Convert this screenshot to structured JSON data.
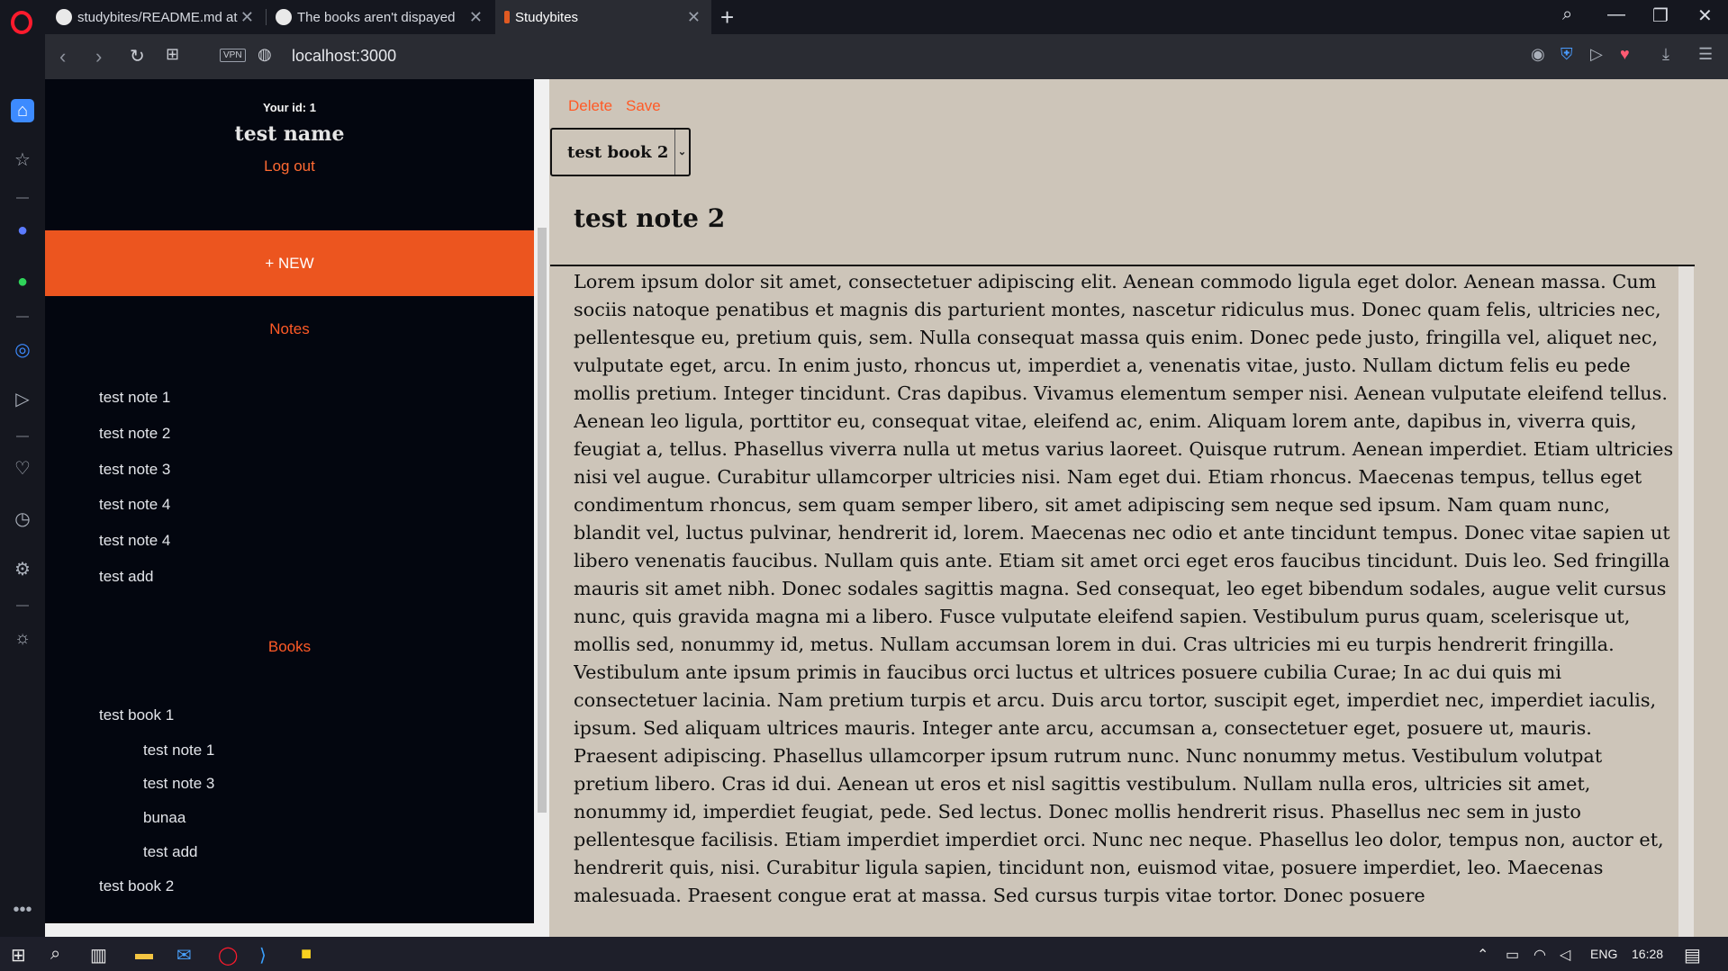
{
  "browser": {
    "tabs": [
      {
        "title": "studybites/README.md at",
        "active": false
      },
      {
        "title": "The books aren't dispayed",
        "active": false
      },
      {
        "title": "Studybites",
        "active": true
      }
    ],
    "url": "localhost:3000",
    "vpn_label": "VPN"
  },
  "sidebar": {
    "user_id_label": "Your id: 1",
    "user_name": "test name",
    "logout_label": "Log out",
    "new_button_label": "+ NEW",
    "notes_heading": "Notes",
    "notes": [
      "test note 1",
      "test note 2",
      "test note 3",
      "test note 4",
      "test note 4",
      "test add"
    ],
    "books_heading": "Books",
    "books": [
      {
        "title": "test book 1",
        "notes": [
          "test note 1",
          "test note 3",
          "bunaa",
          "test add"
        ]
      },
      {
        "title": "test book 2",
        "notes": []
      }
    ]
  },
  "main": {
    "delete_label": "Delete",
    "save_label": "Save",
    "selected_book": "test book 2",
    "note_title": "test note 2",
    "note_body": "Lorem ipsum dolor sit amet, consectetuer adipiscing elit. Aenean commodo ligula eget dolor. Aenean massa. Cum sociis natoque penatibus et magnis dis parturient montes, nascetur ridiculus mus. Donec quam felis, ultricies nec, pellentesque eu, pretium quis, sem. Nulla consequat massa quis enim. Donec pede justo, fringilla vel, aliquet nec, vulputate eget, arcu. In enim justo, rhoncus ut, imperdiet a, venenatis vitae, justo. Nullam dictum felis eu pede mollis pretium. Integer tincidunt. Cras dapibus. Vivamus elementum semper nisi. Aenean vulputate eleifend tellus. Aenean leo ligula, porttitor eu, consequat vitae, eleifend ac, enim. Aliquam lorem ante, dapibus in, viverra quis, feugiat a, tellus. Phasellus viverra nulla ut metus varius laoreet. Quisque rutrum. Aenean imperdiet. Etiam ultricies nisi vel augue. Curabitur ullamcorper ultricies nisi. Nam eget dui. Etiam rhoncus. Maecenas tempus, tellus eget condimentum rhoncus, sem quam semper libero, sit amet adipiscing sem neque sed ipsum. Nam quam nunc, blandit vel, luctus pulvinar, hendrerit id, lorem. Maecenas nec odio et ante tincidunt tempus. Donec vitae sapien ut libero venenatis faucibus. Nullam quis ante. Etiam sit amet orci eget eros faucibus tincidunt. Duis leo. Sed fringilla mauris sit amet nibh. Donec sodales sagittis magna. Sed consequat, leo eget bibendum sodales, augue velit cursus nunc, quis gravida magna mi a libero. Fusce vulputate eleifend sapien. Vestibulum purus quam, scelerisque ut, mollis sed, nonummy id, metus. Nullam accumsan lorem in dui. Cras ultricies mi eu turpis hendrerit fringilla. Vestibulum ante ipsum primis in faucibus orci luctus et ultrices posuere cubilia Curae; In ac dui quis mi consectetuer lacinia. Nam pretium turpis et arcu. Duis arcu tortor, suscipit eget, imperdiet nec, imperdiet iaculis, ipsum. Sed aliquam ultrices mauris. Integer ante arcu, accumsan a, consectetuer eget, posuere ut, mauris. Praesent adipiscing. Phasellus ullamcorper ipsum rutrum nunc. Nunc nonummy metus. Vestibulum volutpat pretium libero. Cras id dui. Aenean ut eros et nisl sagittis vestibulum. Nullam nulla eros, ultricies sit amet, nonummy id, imperdiet feugiat, pede. Sed lectus. Donec mollis hendrerit risus. Phasellus nec sem in justo pellentesque facilisis. Etiam imperdiet imperdiet orci. Nunc nec neque. Phasellus leo dolor, tempus non, auctor et, hendrerit quis, nisi. Curabitur ligula sapien, tincidunt non, euismod vitae, posuere imperdiet, leo. Maecenas malesuada. Praesent congue erat at massa. Sed cursus turpis vitae tortor. Donec posuere"
  },
  "taskbar": {
    "language": "ENG",
    "time": "16:28"
  },
  "colors": {
    "accent": "#ec551f",
    "link": "#ff5a26",
    "sidebar_bg": "#03060f",
    "main_bg": "#cdc5b9"
  }
}
